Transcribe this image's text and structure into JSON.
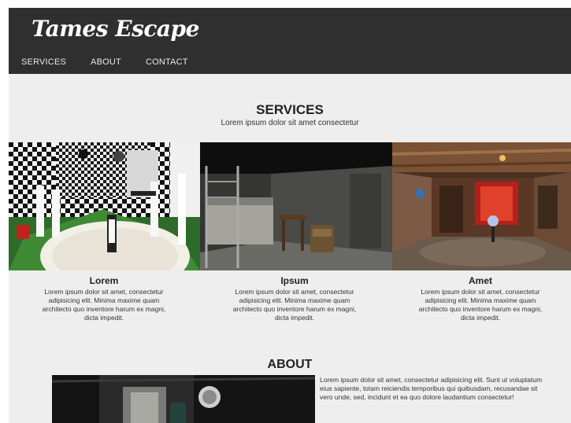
{
  "header": {
    "brand": "Tames Escape",
    "nav": [
      "SERVICES",
      "ABOUT",
      "CONTACT"
    ]
  },
  "services": {
    "title": "SERVICES",
    "subtitle": "Lorem ipsum dolor sit amet consectetur",
    "cards": [
      {
        "title": "Lorem",
        "text": "Lorem ipsum dolor sit amet, consectetur adipisicing elit. Minima maxime quam architecto quo inventore harum ex magni, dicta impedit."
      },
      {
        "title": "Ipsum",
        "text": "Lorem ipsum dolor sit amet, consectetur adipisicing elit. Minima maxime quam architecto quo inventore harum ex magni, dicta impedit."
      },
      {
        "title": "Amet",
        "text": "Lorem ipsum dolor sit amet, consectetur adipisicing elit. Minima maxime quam architecto quo inventore harum ex magni, dicta impedit."
      }
    ]
  },
  "about": {
    "title": "ABOUT",
    "text": "Lorem ipsum dolor sit amet, consectetur adipisicing elit. Sunt ut voluptatum eius sapiente, totam reiciendis temporibus qui quibusdam, recusandae sit vero unde, sed, incidunt et ea quo dolore laudantium consectetur!"
  },
  "colors": {
    "header_bg": "#2f2f2f",
    "page_bg": "#eeeeee",
    "text": "#333333"
  }
}
